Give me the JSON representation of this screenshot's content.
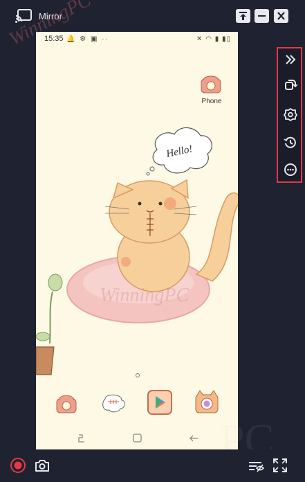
{
  "window": {
    "title": "Mirror"
  },
  "titlebar_buttons": [
    {
      "name": "pin-icon"
    },
    {
      "name": "minimize-icon"
    },
    {
      "name": "close-icon"
    }
  ],
  "phone": {
    "status": {
      "time": "15:35",
      "left_icons": "🔔 ⚙ ▣ ··",
      "right_icons": "✕ ◠ ▮ ▮▯"
    },
    "apps": {
      "phone_label": "Phone"
    },
    "speech_bubble": "Hello!"
  },
  "side_panel": {
    "items": [
      "collapse-icon",
      "rotate-icon",
      "settings-icon",
      "history-icon",
      "more-icon"
    ]
  },
  "bottom_bar": {
    "items": [
      "record-icon",
      "screenshot-icon",
      "hide-icon",
      "fullscreen-icon"
    ]
  },
  "watermark": {
    "text": "WinningPC",
    "text2": "PC"
  },
  "colors": {
    "bg": "#1f2230",
    "accent_red": "#e53946",
    "phone_bg": "#fdf9e4"
  }
}
